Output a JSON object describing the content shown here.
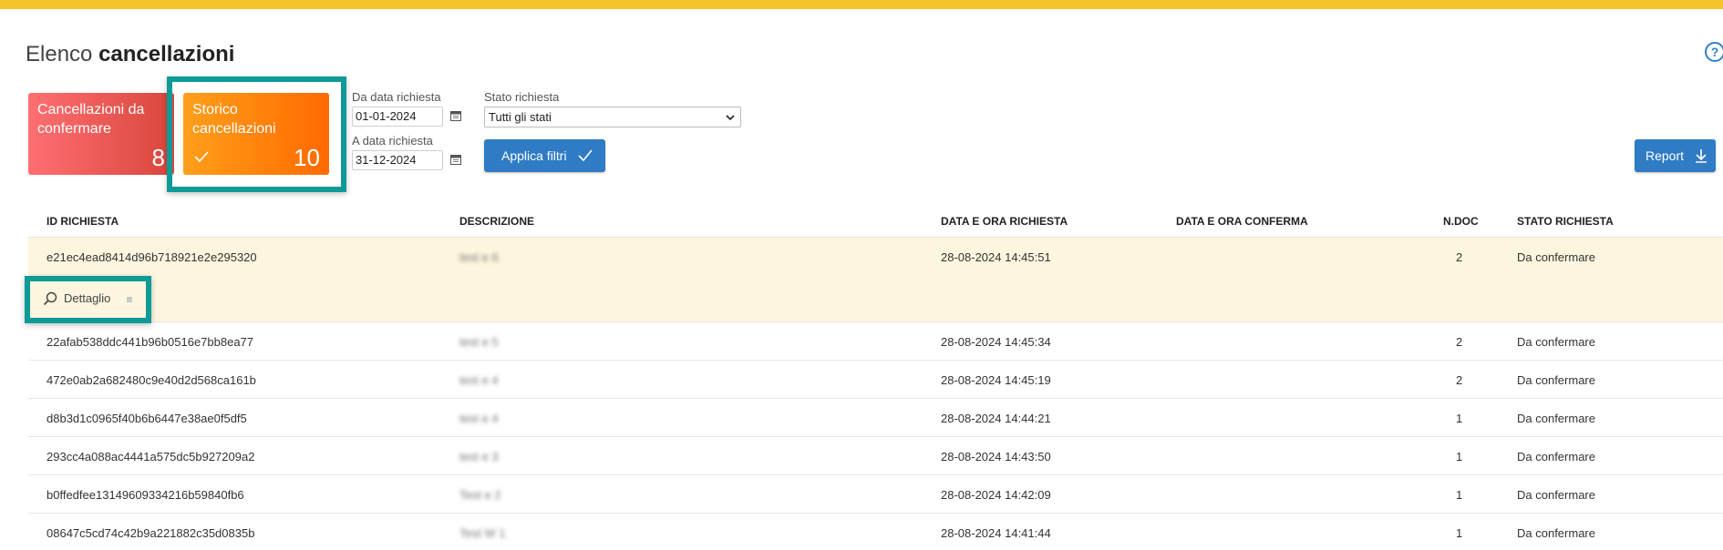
{
  "header": {
    "title_light": "Elenco",
    "title_bold": "cancellazioni",
    "help_icon": "?"
  },
  "cards": [
    {
      "label": "Cancellazioni da confermare",
      "count": "8"
    },
    {
      "label": "Storico cancellazioni",
      "count": "10"
    }
  ],
  "filters": {
    "from_label": "Da data richiesta",
    "from_value": "01-01-2024",
    "to_label": "A data richiesta",
    "to_value": "31-12-2024",
    "status_label": "Stato richiesta",
    "status_value": "Tutti gli stati",
    "apply_label": "Applica filtri",
    "report_label": "Report"
  },
  "table": {
    "headers": [
      "ID RICHIESTA",
      "DESCRIZIONE",
      "DATA E ORA RICHIESTA",
      "DATA E ORA CONFERMA",
      "N.DOC",
      "STATO RICHIESTA"
    ],
    "detail_label": "Dettaglio",
    "rows": [
      {
        "id": "e21ec4ead8414d96b718921e2e295320",
        "desc": "test e 6",
        "requested": "28-08-2024 14:45:51",
        "confirmed": "",
        "ndoc": "2",
        "status": "Da confermare"
      },
      {
        "id": "22afab538ddc441b96b0516e7bb8ea77",
        "desc": "test e 5",
        "requested": "28-08-2024 14:45:34",
        "confirmed": "",
        "ndoc": "2",
        "status": "Da confermare"
      },
      {
        "id": "472e0ab2a682480c9e40d2d568ca161b",
        "desc": "test e 4",
        "requested": "28-08-2024 14:45:19",
        "confirmed": "",
        "ndoc": "2",
        "status": "Da confermare"
      },
      {
        "id": "d8b3d1c0965f40b6b6447e38ae0f5df5",
        "desc": "test e 4",
        "requested": "28-08-2024 14:44:21",
        "confirmed": "",
        "ndoc": "1",
        "status": "Da confermare"
      },
      {
        "id": "293cc4a088ac4441a575dc5b927209a2",
        "desc": "test e 3",
        "requested": "28-08-2024 14:43:50",
        "confirmed": "",
        "ndoc": "1",
        "status": "Da confermare"
      },
      {
        "id": "b0ffedfee13149609334216b59840fb6",
        "desc": "Test e 2",
        "requested": "28-08-2024 14:42:09",
        "confirmed": "",
        "ndoc": "1",
        "status": "Da confermare"
      },
      {
        "id": "08647c5cd74c42b9a221882c35d0835b",
        "desc": "Test W 1",
        "requested": "28-08-2024 14:41:44",
        "confirmed": "",
        "ndoc": "1",
        "status": "Da confermare"
      }
    ]
  },
  "colors": {
    "topbar": "#f5c42c",
    "card_confirm": "#e0574f",
    "card_storico": "#ff7f0e",
    "highlight": "#0e9a96",
    "button": "#2f7bc4",
    "selected_row": "#fcf6df"
  }
}
